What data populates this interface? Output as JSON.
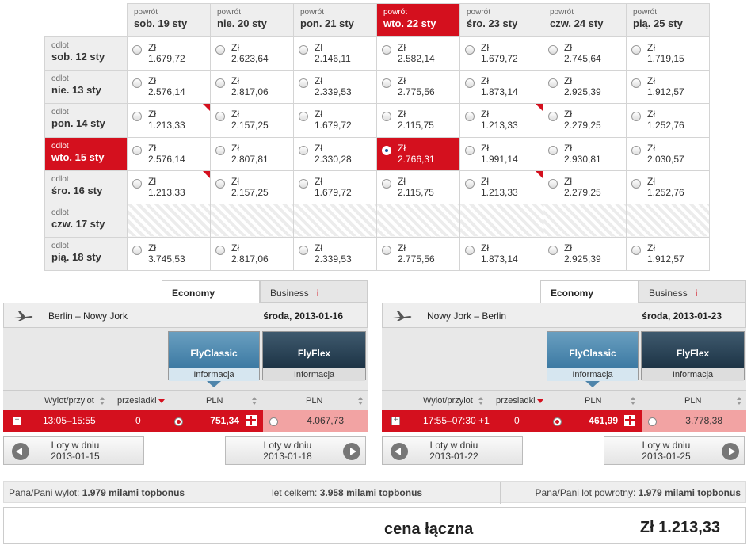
{
  "matrix": {
    "return_label": "powrót",
    "depart_label": "odlot",
    "currency": "Zł",
    "return_dates": [
      "sob. 19 sty",
      "nie. 20 sty",
      "pon. 21 sty",
      "wto. 22 sty",
      "śro. 23 sty",
      "czw. 24 sty",
      "pią. 25 sty"
    ],
    "depart_dates": [
      "sob. 12 sty",
      "nie. 13 sty",
      "pon. 14 sty",
      "wto. 15 sty",
      "śro. 16 sty",
      "czw. 17 sty",
      "pią. 18 sty"
    ],
    "selected_return_index": 3,
    "selected_depart_index": 3,
    "rows": [
      [
        "1.679,72",
        "2.623,64",
        "2.146,11",
        "2.582,14",
        "1.679,72",
        "2.745,64",
        "1.719,15"
      ],
      [
        "2.576,14",
        "2.817,06",
        "2.339,53",
        "2.775,56",
        "1.873,14",
        "2.925,39",
        "1.912,57"
      ],
      [
        "1.213,33",
        "2.157,25",
        "1.679,72",
        "2.115,75",
        "1.213,33",
        "2.279,25",
        "1.252,76"
      ],
      [
        "2.576,14",
        "2.807,81",
        "2.330,28",
        "2.766,31",
        "1.991,14",
        "2.930,81",
        "2.030,57"
      ],
      [
        "1.213,33",
        "2.157,25",
        "1.679,72",
        "2.115,75",
        "1.213,33",
        "2.279,25",
        "1.252,76"
      ],
      null,
      [
        "3.745,53",
        "2.817,06",
        "2.339,53",
        "2.775,56",
        "1.873,14",
        "2.925,39",
        "1.912,57"
      ]
    ],
    "flag_cells": [
      [
        2,
        0
      ],
      [
        4,
        0
      ],
      [
        2,
        4
      ],
      [
        4,
        4
      ]
    ]
  },
  "outbound": {
    "tab_economy": "Economy",
    "tab_business": "Business",
    "info_i": "i",
    "route": "Berlin – Nowy Jork",
    "date": "środa, 2013-01-16",
    "fare1": "FlyClassic",
    "fare2": "FlyFlex",
    "fare_info": "Informacja",
    "col_time": "Wylot/przylot",
    "col_stops": "przesiadki",
    "col_pln": "PLN",
    "time": "13:05–15:55",
    "stops": "0",
    "price1": "751,34",
    "price2": "4.067,73",
    "prev_label": "Loty w dniu",
    "prev_date": "2013-01-15",
    "next_label": "Loty w dniu",
    "next_date": "2013-01-18"
  },
  "inbound": {
    "tab_economy": "Economy",
    "tab_business": "Business",
    "info_i": "i",
    "route": "Nowy Jork – Berlin",
    "date": "środa, 2013-01-23",
    "fare1": "FlyClassic",
    "fare2": "FlyFlex",
    "fare_info": "Informacja",
    "col_time": "Wylot/przylot",
    "col_stops": "przesiadki",
    "col_pln": "PLN",
    "time": "17:55–07:30 +1",
    "stops": "0",
    "price1": "461,99",
    "price2": "3.778,38",
    "prev_label": "Loty w dniu",
    "prev_date": "2013-01-22",
    "next_label": "Loty w dniu",
    "next_date": "2013-01-25"
  },
  "bonus": {
    "out_label": "Pana/Pani wylot:",
    "out_value": "1.979 milami topbonus",
    "total_label": "let celkem:",
    "total_value": "3.958 milami topbonus",
    "ret_label": "Pana/Pani lot powrotny:",
    "ret_value": "1.979 milami topbonus"
  },
  "total": {
    "label": "cena łączna",
    "amount": "Zł 1.213,33"
  },
  "colors": {
    "accent": "#d4101e",
    "flyclassic": "#4f85ab",
    "flyflex": "#2a4356"
  }
}
